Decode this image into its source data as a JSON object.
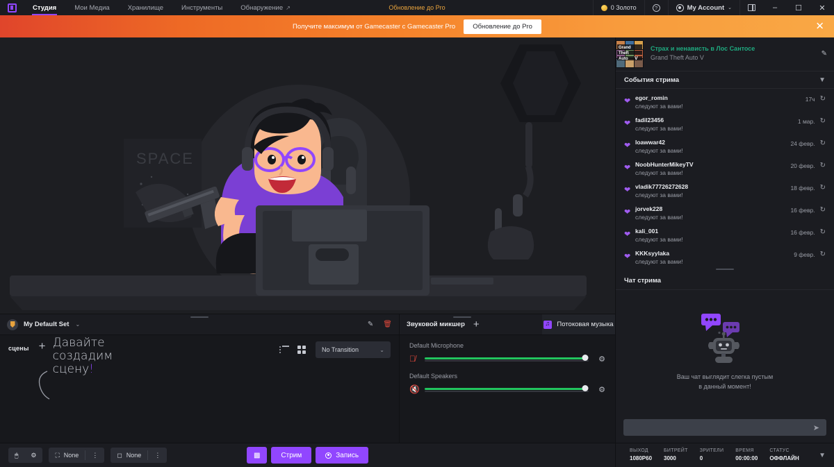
{
  "titlebar": {
    "logo_icon": "gamecaster-logo-icon",
    "nav": [
      {
        "label": "Студия",
        "active": true,
        "external": false
      },
      {
        "label": "Мои Медиа",
        "active": false,
        "external": false
      },
      {
        "label": "Хранилище",
        "active": false,
        "external": false
      },
      {
        "label": "Инструменты",
        "active": false,
        "external": false
      },
      {
        "label": "Обнаружение",
        "active": false,
        "external": true
      }
    ],
    "center_link": "Обновление до Pro",
    "gold_label": "0 Золото",
    "help_glyph": "?",
    "account_label": "My Account",
    "account_caret": "⌄",
    "window_buttons": {
      "minimize": "–",
      "maximize": "☐",
      "close": "✕"
    }
  },
  "promo": {
    "text": "Получите максимум от Gamecaster с Gamecaster Pro",
    "button": "Обновление до Pro",
    "close_glyph": "✕"
  },
  "preview": {
    "poster_text": "SPACE"
  },
  "scenes": {
    "set_name": "My Default Set",
    "set_caret": "⌄",
    "edit_icon": "pencil-icon",
    "delete_icon": "trash-icon",
    "scenes_label": "сцены",
    "add_glyph": "+",
    "hint_line1": "Давайте",
    "hint_line2": "создадим",
    "hint_line3": "сцену",
    "hint_excl": "!",
    "transition_value": "No Transition",
    "transition_caret": "⌄"
  },
  "mixer": {
    "title": "Звуковой микшер",
    "add_glyph": "+",
    "music_tab": "Потоковая музыка",
    "channels": [
      {
        "label": "Default Microphone",
        "muted": true,
        "volume": 98,
        "mute_icon": "mic-muted-icon",
        "settings_icon": "gear-icon"
      },
      {
        "label": "Default Speakers",
        "muted": true,
        "volume": 98,
        "mute_icon": "speaker-muted-icon",
        "settings_icon": "gear-icon"
      }
    ]
  },
  "right_panel": {
    "game": {
      "title": "Страх и ненависть в Лос Сантосе",
      "subtitle": "Grand Theft Auto V",
      "edit_icon": "pencil-icon"
    },
    "events_header": {
      "title": "События стрима",
      "filter_icon": "filter-icon"
    },
    "events": [
      {
        "name": "egor_romin",
        "desc": "следуют за вами!",
        "time": "17ч",
        "icon": "heart-icon",
        "replay_icon": "replay-icon"
      },
      {
        "name": "fadil23456",
        "desc": "следуют за вами!",
        "time": "1 мар.",
        "icon": "heart-icon",
        "replay_icon": "replay-icon"
      },
      {
        "name": "loawwar42",
        "desc": "следуют за вами!",
        "time": "24 февр.",
        "icon": "heart-icon",
        "replay_icon": "replay-icon"
      },
      {
        "name": "NoobHunterMikeyTV",
        "desc": "следуют за вами!",
        "time": "20 февр.",
        "icon": "heart-icon",
        "replay_icon": "replay-icon"
      },
      {
        "name": "vladik77726272628",
        "desc": "следуют за вами!",
        "time": "18 февр.",
        "icon": "heart-icon",
        "replay_icon": "replay-icon"
      },
      {
        "name": "jorvek228",
        "desc": "следуют за вами!",
        "time": "16 февр.",
        "icon": "heart-icon",
        "replay_icon": "replay-icon"
      },
      {
        "name": "kali_001",
        "desc": "следуют за вами!",
        "time": "16 февр.",
        "icon": "heart-icon",
        "replay_icon": "replay-icon"
      },
      {
        "name": "KKKsyylaka",
        "desc": "следуют за вами!",
        "time": "9 февр.",
        "icon": "heart-icon",
        "replay_icon": "replay-icon"
      }
    ],
    "chat_header": {
      "title": "Чат стрима"
    },
    "chat_empty_line1": "Ваш чат выглядит слегка пустым",
    "chat_empty_line2": "в данный момент!",
    "chat_placeholder": "",
    "send_icon": "send-icon"
  },
  "bottombar": {
    "left_tools": [
      {
        "icon": "cursor-icon",
        "label": ""
      },
      {
        "icon": "gear-icon",
        "label": ""
      }
    ],
    "source_buttons": [
      {
        "icon": "webcam-icon",
        "label": "None",
        "menu": "⋮"
      },
      {
        "icon": "camera-off-icon",
        "label": "None",
        "menu": "⋮"
      }
    ],
    "stream_icon_button": "twitch-icon",
    "stream_label": "Стрим",
    "record_label": "Запись",
    "record_icon": "record-icon"
  },
  "status": {
    "items": [
      {
        "key": "ВЫХОД",
        "value": "1080P60"
      },
      {
        "key": "БИТРЕЙТ",
        "value": "3000"
      },
      {
        "key": "ЗРИТЕЛИ",
        "value": "0"
      },
      {
        "key": "ВРЕМЯ",
        "value": "00:00:00"
      },
      {
        "key": "СТАТУС",
        "value": "ОФФЛАЙН"
      }
    ],
    "expand_icon": "collapse-icon"
  },
  "colors": {
    "accent_purple": "#9146ff",
    "promo_orange": "#f5832b",
    "gold": "#e8a33d",
    "green_title": "#1fa97f",
    "slider_green": "#22c55e",
    "mute_red": "#e0483b"
  }
}
